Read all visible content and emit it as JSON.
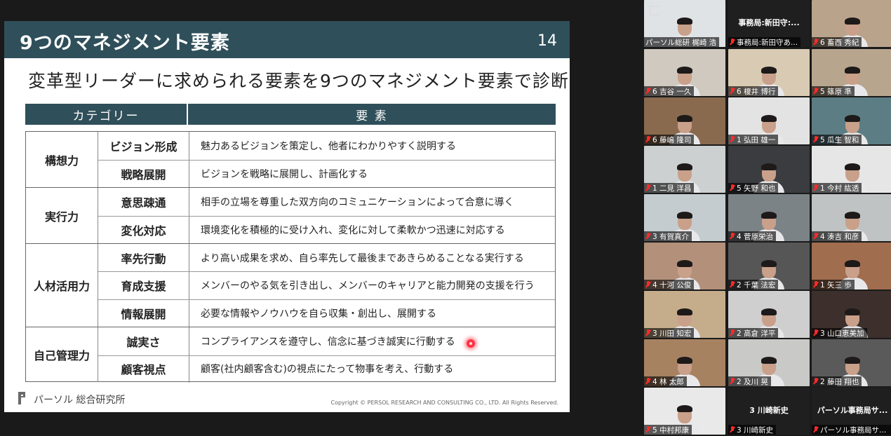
{
  "slide": {
    "title": "9つのマネジメント要素",
    "page": "14",
    "subtitle": "変革型リーダーに求められる要素を9つのマネジメント要素で診断",
    "headers": {
      "category": "カテゴリー",
      "element": "要 素"
    },
    "groups": [
      {
        "label": "構想力",
        "rows": [
          {
            "sub": "ビジョン形成",
            "desc": "魅力あるビジョンを策定し、他者にわかりやすく説明する"
          },
          {
            "sub": "戦略展開",
            "desc": "ビジョンを戦略に展開し、計画化する"
          }
        ]
      },
      {
        "label": "実行力",
        "rows": [
          {
            "sub": "意思疎通",
            "desc": "相手の立場を尊重した双方向のコミュニケーションによって合意に導く"
          },
          {
            "sub": "変化対応",
            "desc": "環境変化を積極的に受け入れ、変化に対して柔軟かつ迅速に対応する"
          }
        ]
      },
      {
        "label": "人材活用力",
        "rows": [
          {
            "sub": "率先行動",
            "desc": "より高い成果を求め、自ら率先して最後まであきらめることなる実行する"
          },
          {
            "sub": "育成支援",
            "desc": "メンバーのやる気を引き出し、メンバーのキャリアと能力開発の支援を行う"
          },
          {
            "sub": "情報展開",
            "desc": "必要な情報やノウハウを自ら収集・創出し、展開する"
          }
        ]
      },
      {
        "label": "自己管理力",
        "rows": [
          {
            "sub": "誠実さ",
            "desc": "コンプライアンスを遵守し、信念に基づき誠実に行動する"
          },
          {
            "sub": "顧客視点",
            "desc": "顧客(社内顧客含む)の視点にたって物事を考え、行動する"
          }
        ]
      }
    ],
    "footer_org": "パーソル 総合研究所",
    "copyright": "Copyright © PERSOL RESEARCH AND CONSULTING CO., LTD. All Rights Reserved."
  },
  "participants": [
    {
      "name": "パーソル総研 梶崎 浩",
      "bg": "#dfe3e6",
      "active": true,
      "muted": false
    },
    {
      "name": "事務局:新田守あ...",
      "big": "事務局:新田守:...",
      "bg": "#1f1f1f",
      "plain": true,
      "muted": true
    },
    {
      "name": "6 畜西 秀紀",
      "bg": "#b9a48b",
      "muted": true
    },
    {
      "name": "6 吉谷 一久",
      "bg": "#cfc9bf",
      "muted": true
    },
    {
      "name": "6 榎井 博行",
      "bg": "#d9cbb3",
      "muted": true
    },
    {
      "name": "5 篠原 準",
      "bg": "#b7a58e",
      "muted": true
    },
    {
      "name": "6 藤嶋 隆司",
      "bg": "#8a6a4f",
      "muted": true
    },
    {
      "name": "1 弘田 雄一",
      "bg": "#e3e3e3",
      "muted": true
    },
    {
      "name": "5 瓜生 智和",
      "bg": "#5c7d83",
      "muted": true
    },
    {
      "name": "1 二見 洋昌",
      "bg": "#cdd0d0",
      "muted": true
    },
    {
      "name": "5 矢野 和也",
      "bg": "#3a3c3f",
      "muted": true
    },
    {
      "name": "1 今村 紘透",
      "bg": "#e6e6e6",
      "muted": true
    },
    {
      "name": "3 有賀真介",
      "bg": "#c5ccd0",
      "muted": true
    },
    {
      "name": "4 菅原栄治",
      "bg": "#7b8387",
      "muted": true
    },
    {
      "name": "4 湊吉 和彦",
      "bg": "#bfc3c3",
      "muted": true
    },
    {
      "name": "4 十河 公俊",
      "bg": "#b3907a",
      "muted": true
    },
    {
      "name": "2 千葉 法宏",
      "bg": "#565656",
      "muted": true
    },
    {
      "name": "1 矢三 歩",
      "bg": "#a06d4f",
      "muted": true
    },
    {
      "name": "3 川田 知宏",
      "bg": "#c5ad8b",
      "muted": true
    },
    {
      "name": "2 高倉 洋平",
      "bg": "#cfcfcf",
      "muted": true
    },
    {
      "name": "3 山口恵美加",
      "bg": "#3c2f2c",
      "muted": true
    },
    {
      "name": "4 林 太郎",
      "bg": "#a78261",
      "muted": true
    },
    {
      "name": "2 及川 晃",
      "bg": "#c9c9c7",
      "muted": true
    },
    {
      "name": "2 藤田 翔也",
      "bg": "#5a5a5a",
      "muted": true
    },
    {
      "name": "5 中村邦康",
      "bg": "#e9e9e9",
      "muted": true
    },
    {
      "name": "3 川崎新史",
      "big": "3 川崎新史",
      "bg": "#1f1f1f",
      "plain": true,
      "muted": true
    },
    {
      "name": "パーソル事務局サポ...",
      "big": "パーソル事務局サ...",
      "bg": "#1f1f1f",
      "plain": true,
      "muted": true
    }
  ]
}
